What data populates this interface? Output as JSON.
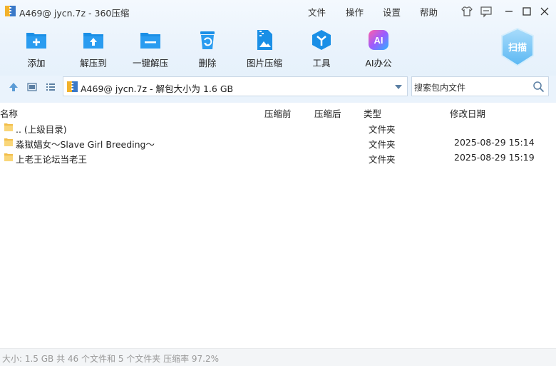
{
  "window": {
    "title": "A469@ jycn.7z - 360压缩",
    "menu": [
      "文件",
      "操作",
      "设置",
      "帮助"
    ]
  },
  "toolbar": {
    "items": [
      {
        "label": "添加",
        "icon": "add-icon"
      },
      {
        "label": "解压到",
        "icon": "extract-to-icon"
      },
      {
        "label": "一键解压",
        "icon": "one-click-extract-icon"
      },
      {
        "label": "删除",
        "icon": "delete-icon"
      },
      {
        "label": "图片压缩",
        "icon": "image-compress-icon"
      },
      {
        "label": "工具",
        "icon": "tools-icon"
      },
      {
        "label": "AI办公",
        "icon": "ai-office-icon"
      }
    ],
    "scan_label": "扫描"
  },
  "address": {
    "path": "A469@ jycn.7z - 解包大小为 1.6 GB",
    "search_placeholder": "搜索包内文件"
  },
  "columns": {
    "name": "名称",
    "before": "压缩前",
    "after": "压缩后",
    "type": "类型",
    "modified": "修改日期"
  },
  "files": [
    {
      "name": ".. (上级目录)",
      "type": "文件夹",
      "modified": ""
    },
    {
      "name": "淼獄娼女～Slave Girl Breeding～",
      "type": "文件夹",
      "modified": "2025-08-29 15:14"
    },
    {
      "name": "上老王论坛当老王",
      "type": "文件夹",
      "modified": "2025-08-29 15:19"
    }
  ],
  "status": {
    "text": "大小: 1.5 GB 共 46 个文件和 5 个文件夹 压缩率 97.2%"
  },
  "colors": {
    "accent": "#1a8fe6",
    "folder": "#f7c95a",
    "toolbar_bg": "#eaf3fc"
  }
}
